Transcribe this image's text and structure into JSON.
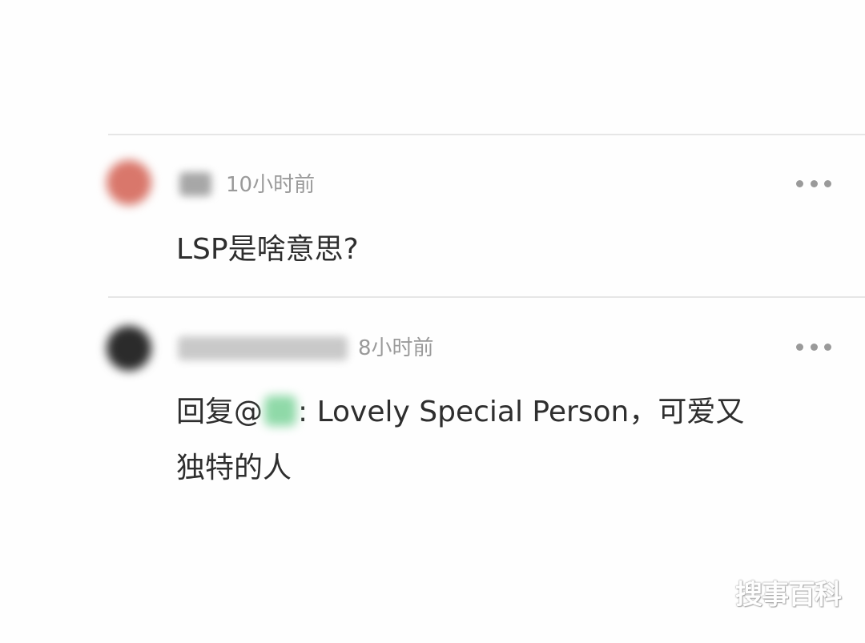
{
  "comments": [
    {
      "time": "10小时前",
      "text": "LSP是啥意思?"
    },
    {
      "time": "8小时前",
      "reply_prefix": "回复@",
      "text_after_mention": ": Lovely Special Person，可爱又",
      "text_line2": "独特的人"
    }
  ],
  "more_icon": "more-dots-icon",
  "watermark": "搜事百科",
  "colors": {
    "time_text": "#9a9a9a",
    "body_text": "#2e2e2e",
    "divider": "#e6e6e6",
    "mention_highlight": "#8fd9a8"
  }
}
